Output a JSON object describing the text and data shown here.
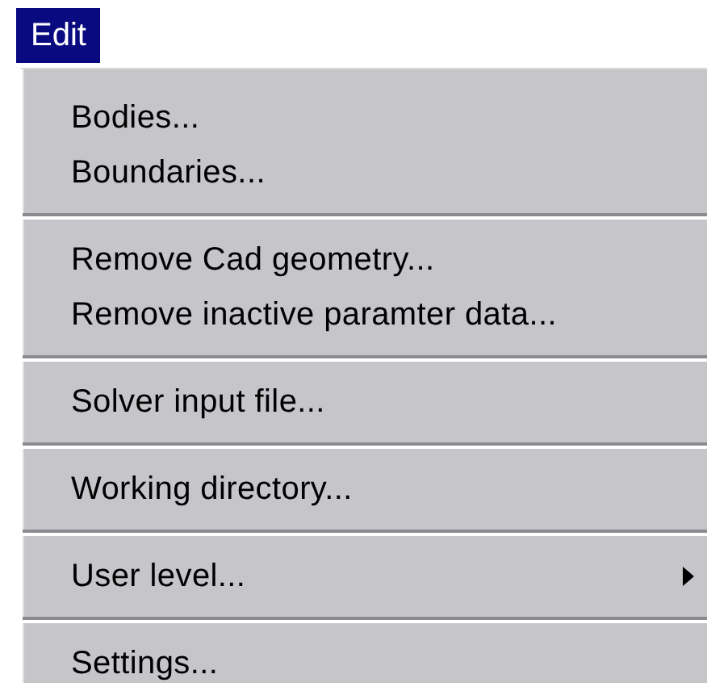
{
  "menu_bar": {
    "title": "Edit",
    "selected": true
  },
  "menu": {
    "sections": [
      {
        "items": [
          {
            "label": "Bodies...",
            "kind": "command"
          },
          {
            "label": "Boundaries...",
            "kind": "command"
          }
        ]
      },
      {
        "items": [
          {
            "label": "Remove Cad geometry...",
            "kind": "command"
          },
          {
            "label": "Remove inactive paramter data...",
            "kind": "command"
          }
        ]
      },
      {
        "items": [
          {
            "label": "Solver input file...",
            "kind": "command"
          }
        ]
      },
      {
        "items": [
          {
            "label": "Working directory...",
            "kind": "command"
          }
        ]
      },
      {
        "items": [
          {
            "label": "User level...",
            "kind": "submenu"
          }
        ]
      },
      {
        "items": [
          {
            "label": "Settings...",
            "kind": "command"
          }
        ]
      }
    ]
  }
}
